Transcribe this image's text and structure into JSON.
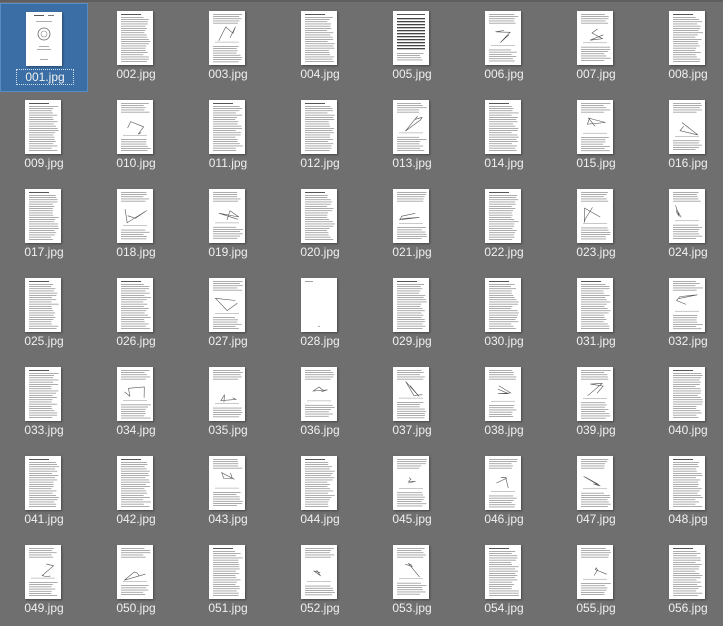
{
  "window": {
    "background": "#6f6f6f",
    "selection_color": "#3b6ea5"
  },
  "files": [
    {
      "name": "001.jpg",
      "selected": true,
      "thumb": "title-page-icon"
    },
    {
      "name": "002.jpg",
      "thumb": "text-page-icon"
    },
    {
      "name": "003.jpg",
      "thumb": "figure-page-icon"
    },
    {
      "name": "004.jpg",
      "thumb": "text-page-icon"
    },
    {
      "name": "005.jpg",
      "thumb": "table-page-icon"
    },
    {
      "name": "006.jpg",
      "thumb": "figure-page-icon"
    },
    {
      "name": "007.jpg",
      "thumb": "figure-page-icon"
    },
    {
      "name": "008.jpg",
      "thumb": "text-page-icon"
    },
    {
      "name": "009.jpg",
      "thumb": "text-page-icon"
    },
    {
      "name": "010.jpg",
      "thumb": "figure-page-icon"
    },
    {
      "name": "011.jpg",
      "thumb": "text-page-icon"
    },
    {
      "name": "012.jpg",
      "thumb": "text-page-icon"
    },
    {
      "name": "013.jpg",
      "thumb": "figure-page-icon"
    },
    {
      "name": "014.jpg",
      "thumb": "text-page-icon"
    },
    {
      "name": "015.jpg",
      "thumb": "figure-page-icon"
    },
    {
      "name": "016.jpg",
      "thumb": "figure-page-icon"
    },
    {
      "name": "017.jpg",
      "thumb": "text-page-icon"
    },
    {
      "name": "018.jpg",
      "thumb": "figure-page-icon"
    },
    {
      "name": "019.jpg",
      "thumb": "figure-page-icon"
    },
    {
      "name": "020.jpg",
      "thumb": "text-page-icon"
    },
    {
      "name": "021.jpg",
      "thumb": "figure-page-icon"
    },
    {
      "name": "022.jpg",
      "thumb": "text-page-icon"
    },
    {
      "name": "023.jpg",
      "thumb": "figure-page-icon"
    },
    {
      "name": "024.jpg",
      "thumb": "figure-page-icon"
    },
    {
      "name": "025.jpg",
      "thumb": "text-page-icon"
    },
    {
      "name": "026.jpg",
      "thumb": "text-page-icon"
    },
    {
      "name": "027.jpg",
      "thumb": "figure-page-icon"
    },
    {
      "name": "028.jpg",
      "thumb": "blank-page-icon"
    },
    {
      "name": "029.jpg",
      "thumb": "text-page-icon"
    },
    {
      "name": "030.jpg",
      "thumb": "text-page-icon"
    },
    {
      "name": "031.jpg",
      "thumb": "text-page-icon"
    },
    {
      "name": "032.jpg",
      "thumb": "figure-page-icon"
    },
    {
      "name": "033.jpg",
      "thumb": "text-page-icon"
    },
    {
      "name": "034.jpg",
      "thumb": "figure-page-icon"
    },
    {
      "name": "035.jpg",
      "thumb": "figure-page-icon"
    },
    {
      "name": "036.jpg",
      "thumb": "figure-page-icon"
    },
    {
      "name": "037.jpg",
      "thumb": "figure-page-icon"
    },
    {
      "name": "038.jpg",
      "thumb": "figure-page-icon"
    },
    {
      "name": "039.jpg",
      "thumb": "figure-page-icon"
    },
    {
      "name": "040.jpg",
      "thumb": "text-page-icon"
    },
    {
      "name": "041.jpg",
      "thumb": "text-page-icon"
    },
    {
      "name": "042.jpg",
      "thumb": "text-page-icon"
    },
    {
      "name": "043.jpg",
      "thumb": "figure-page-icon"
    },
    {
      "name": "044.jpg",
      "thumb": "text-page-icon"
    },
    {
      "name": "045.jpg",
      "thumb": "figure-page-icon"
    },
    {
      "name": "046.jpg",
      "thumb": "figure-page-icon"
    },
    {
      "name": "047.jpg",
      "thumb": "figure-page-icon"
    },
    {
      "name": "048.jpg",
      "thumb": "text-page-icon"
    },
    {
      "name": "049.jpg",
      "thumb": "figure-page-icon"
    },
    {
      "name": "050.jpg",
      "thumb": "figure-page-icon"
    },
    {
      "name": "051.jpg",
      "thumb": "text-page-icon"
    },
    {
      "name": "052.jpg",
      "thumb": "figure-page-icon"
    },
    {
      "name": "053.jpg",
      "thumb": "figure-page-icon"
    },
    {
      "name": "054.jpg",
      "thumb": "text-page-icon"
    },
    {
      "name": "055.jpg",
      "thumb": "figure-page-icon"
    },
    {
      "name": "056.jpg",
      "thumb": "text-page-icon"
    }
  ]
}
